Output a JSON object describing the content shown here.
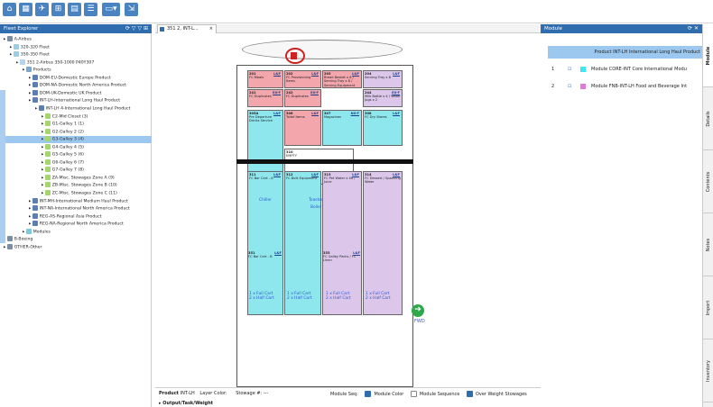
{
  "explorer": {
    "title": "Fleet Explorer",
    "tree": [
      {
        "label": "A-Airbus",
        "indent": 0,
        "icon": "airline-icon"
      },
      {
        "label": "320-320 Fleet",
        "indent": 1,
        "icon": "fleet-icon"
      },
      {
        "label": "350-350 Fleet",
        "indent": 1,
        "icon": "fleet-icon"
      },
      {
        "label": "351 2-Airbus 350-1000 P40Y307",
        "indent": 2,
        "icon": "aircraft-icon"
      },
      {
        "label": "Products",
        "indent": 3,
        "icon": "products-icon"
      },
      {
        "label": "DOM-EU-Domestic Europe Product",
        "indent": 4,
        "icon": "product-icon"
      },
      {
        "label": "DOM-NA-Domestic North America Product",
        "indent": 4,
        "icon": "product-icon"
      },
      {
        "label": "DOM-UK-Domestic UK Product",
        "indent": 4,
        "icon": "product-icon"
      },
      {
        "label": "INT-LH-International Long Haul Product",
        "indent": 4,
        "icon": "product-icon"
      },
      {
        "label": "INT-LH 4-International Long Haul Product",
        "indent": 5,
        "icon": "product-icon"
      },
      {
        "label": "C2-Mid Closet (3)",
        "indent": 6,
        "icon": "galley-icon"
      },
      {
        "label": "G1-Galley 1 (1)",
        "indent": 6,
        "icon": "galley-icon"
      },
      {
        "label": "G2-Galley 2 (2)",
        "indent": 6,
        "icon": "galley-icon"
      },
      {
        "label": "G3-Galley 3 (4)",
        "indent": 6,
        "icon": "galley-icon",
        "selected": true
      },
      {
        "label": "G4-Galley 4 (5)",
        "indent": 6,
        "icon": "galley-icon"
      },
      {
        "label": "G5-Galley 5 (6)",
        "indent": 6,
        "icon": "galley-icon"
      },
      {
        "label": "G6-Galley 6 (7)",
        "indent": 6,
        "icon": "galley-icon"
      },
      {
        "label": "G7-Galley 7 (8)",
        "indent": 6,
        "icon": "galley-icon"
      },
      {
        "label": "ZA-Misc. Stowages Zone A (9)",
        "indent": 6,
        "icon": "galley-icon"
      },
      {
        "label": "ZB-Misc. Stowages Zone B (10)",
        "indent": 6,
        "icon": "galley-icon"
      },
      {
        "label": "ZC-Misc. Stowages Zone C (11)",
        "indent": 6,
        "icon": "galley-icon"
      },
      {
        "label": "INT-MH-International Medium Haul Product",
        "indent": 4,
        "icon": "product-icon"
      },
      {
        "label": "INT-NA-International North America Product",
        "indent": 4,
        "icon": "product-icon"
      },
      {
        "label": "REG-AS-Regional Asia Product",
        "indent": 4,
        "icon": "product-icon"
      },
      {
        "label": "REG-NA-Regional North America Product",
        "indent": 4,
        "icon": "product-icon"
      },
      {
        "label": "Modules",
        "indent": 3,
        "icon": "modules-icon"
      },
      {
        "label": "B-Boeing",
        "indent": 0,
        "icon": "airline-icon"
      },
      {
        "label": "OTHER-Other",
        "indent": 0,
        "icon": "airline-icon"
      }
    ]
  },
  "editor": {
    "tab_label": "351 2, INT-L...",
    "tab_close": "×",
    "boxes": [
      {
        "num": "201",
        "text": "FC Meals",
        "lbl": "L&F",
        "color": "pink"
      },
      {
        "num": "202",
        "text": "FC Provisioning Items",
        "lbl": "L&F",
        "color": "pink"
      },
      {
        "num": "203",
        "text": "Bread Basket x 8 / Serving Tray x 8 / Serving Equipment",
        "lbl": "L&F",
        "color": "pink"
      },
      {
        "num": "204",
        "text": "Serving Tray x 8",
        "lbl": "L&F",
        "color": "lav"
      },
      {
        "num": "241",
        "text": "FC Duplicates",
        "lbl": "EX-F",
        "color": "pink"
      },
      {
        "num": "242",
        "text": "FC Duplicates",
        "lbl": "EX-F",
        "color": "pink"
      },
      {
        "num": "244",
        "text": "Milk Bottle x 4 / Water Jugs x 2",
        "lbl": "EX-F",
        "color": "lav"
      },
      {
        "num": "305A",
        "text": "Pre Departure Drinks Service",
        "lbl": "L&F",
        "color": "cyan"
      },
      {
        "num": "306",
        "text": "Toilet Items",
        "lbl": "L&F",
        "color": "pink"
      },
      {
        "num": "307",
        "text": "Magazines",
        "lbl": "NX-F",
        "color": "cyan"
      },
      {
        "num": "308",
        "text": "FC Dry Stores",
        "lbl": "L&F",
        "color": "cyan"
      },
      {
        "num": "310",
        "text": "EMPTY",
        "lbl": "",
        "color": "white"
      },
      {
        "num": "311",
        "text": "FC Bar Cart - A",
        "lbl": "L&F",
        "color": "cyan"
      },
      {
        "num": "312",
        "text": "FC Bulk Equipment",
        "lbl": "L&F",
        "color": "cyan"
      },
      {
        "num": "313",
        "text": "FC Pet Water x 48 / Juice",
        "lbl": "L&F",
        "color": "lav"
      },
      {
        "num": "314",
        "text": "FC Dessert / Sparkling Water",
        "lbl": "L&F",
        "color": "lav"
      },
      {
        "num": "351",
        "text": "FC Bar Cart - B",
        "lbl": "L&F",
        "color": "cyan"
      },
      {
        "num": "353",
        "text": "FC Galley Packs / FC Linen",
        "lbl": "L&F",
        "color": "pink"
      }
    ],
    "chiller_label": "Chiller",
    "toaster_label": "Toaster",
    "boiler_label": "Boiler",
    "cart_text": "1 x Full Cart\n2 x Half Cart",
    "cart_line1": "1 x Full Cart",
    "cart_line2": "2 x Half Cart",
    "fwd_label": "FWD"
  },
  "status": {
    "product_label": "Product",
    "product_value": "INT-LH",
    "layer_label": "Layer Color:",
    "stowage_label": "Stowage #:",
    "stowage_value": "---",
    "module_seq_label": "Module Seq:",
    "module_color": "Module Color",
    "module_sequence": "Module Sequence",
    "over_weight": "Over Weight Stowages",
    "output_label": "Output/Task/Weight"
  },
  "module": {
    "title": "Module",
    "header": "Product INT-LH International Long Haul Product",
    "rows": [
      {
        "num": "1",
        "label": "Module CORE-INT Core International Modu",
        "color": "#3ee6ef"
      },
      {
        "num": "2",
        "label": "Module FNB-INT-LH Food and Beverage Int",
        "color": "#e07bd9"
      }
    ]
  },
  "right_tabs": [
    "Module",
    "Details",
    "Contents",
    "Notes",
    "Import",
    "Inventory"
  ],
  "colors": {
    "accent": "#2f6dae",
    "selected": "#9cc8ef",
    "pink": "#f3a7ad",
    "cyan": "#8fe7ee",
    "lavender": "#dcc7ea"
  }
}
